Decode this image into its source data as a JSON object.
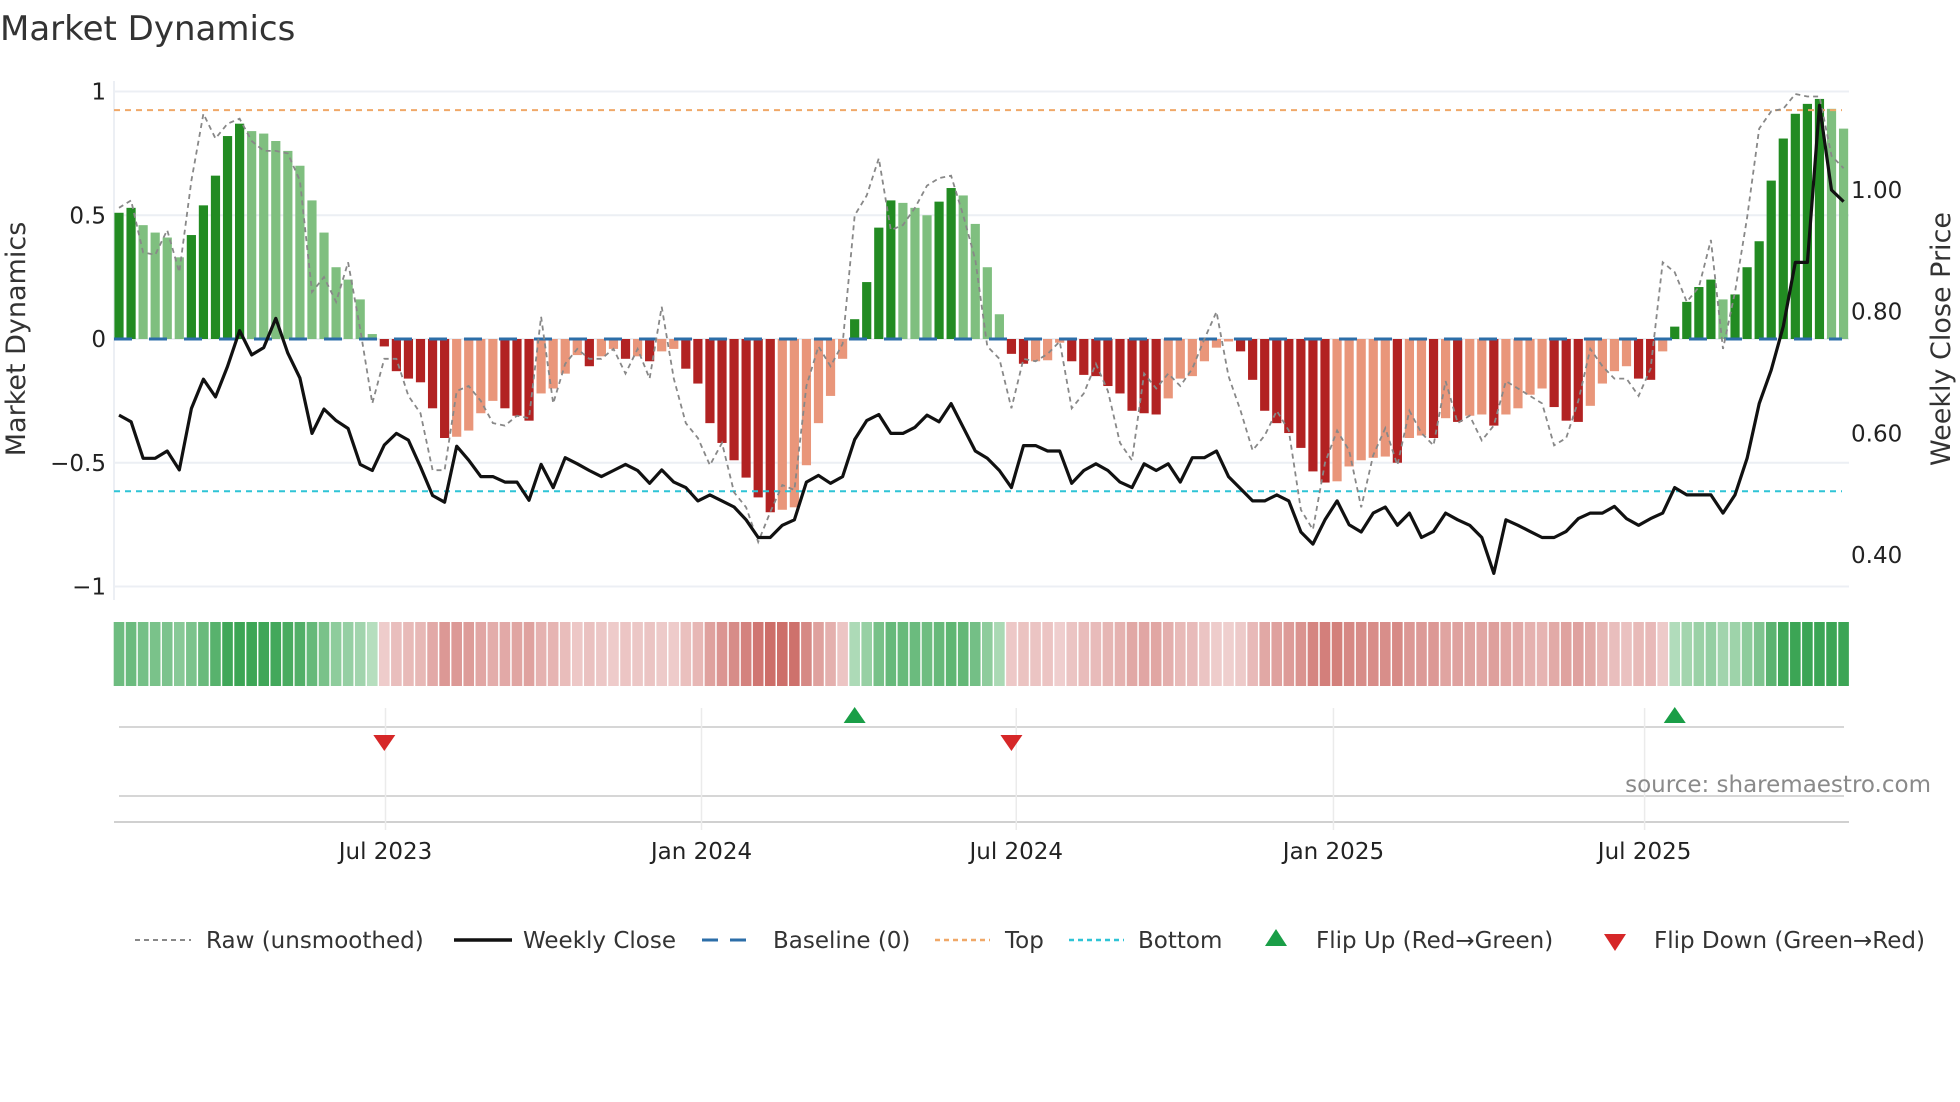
{
  "chart_data": {
    "type": "bar",
    "title": "Market Dynamics",
    "ylabel": "Market Dynamics",
    "ylabel_right": "Weekly Close Price",
    "xlabel": "",
    "ylim": [
      -1.055,
      1.04
    ],
    "ylim_right": [
      0.38,
      1.16
    ],
    "grid": true,
    "legend_placement": "bottom",
    "yticks": [
      {
        "value": 1,
        "label": "1"
      },
      {
        "value": 0.5,
        "label": "0.5"
      },
      {
        "value": 0,
        "label": "0"
      },
      {
        "value": -0.5,
        "label": "−0.5"
      },
      {
        "value": -1,
        "label": "−1"
      }
    ],
    "yticks_right": [
      {
        "value": 1.0,
        "label": "1.00"
      },
      {
        "value": 0.8,
        "label": "0.80"
      },
      {
        "value": 0.6,
        "label": "0.60"
      },
      {
        "value": 0.4,
        "label": "0.40"
      }
    ],
    "xticks": [
      {
        "week": 22.1,
        "label": "Jul 2023"
      },
      {
        "week": 48.3,
        "label": "Jan 2024"
      },
      {
        "week": 74.4,
        "label": "Jul 2024"
      },
      {
        "week": 100.7,
        "label": "Jan 2025"
      },
      {
        "week": 126.5,
        "label": "Jul 2025"
      }
    ],
    "thresholds": {
      "top": 0.925,
      "bottom": -0.615,
      "baseline": 0
    },
    "series": [
      {
        "name": "Market Dynamics (smoothed)",
        "values": [
          0.51,
          0.53,
          0.46,
          0.43,
          0.41,
          0.33,
          0.42,
          0.54,
          0.66,
          0.82,
          0.87,
          0.84,
          0.83,
          0.8,
          0.76,
          0.7,
          0.56,
          0.43,
          0.29,
          0.24,
          0.16,
          0.02,
          -0.03,
          -0.13,
          -0.16,
          -0.175,
          -0.28,
          -0.4,
          -0.395,
          -0.37,
          -0.3,
          -0.25,
          -0.28,
          -0.31,
          -0.33,
          -0.22,
          -0.2,
          -0.14,
          -0.065,
          -0.11,
          -0.07,
          -0.04,
          -0.08,
          -0.07,
          -0.09,
          -0.05,
          -0.04,
          -0.12,
          -0.18,
          -0.34,
          -0.42,
          -0.49,
          -0.56,
          -0.64,
          -0.7,
          -0.69,
          -0.68,
          -0.51,
          -0.34,
          -0.23,
          -0.08,
          0.08,
          0.23,
          0.45,
          0.56,
          0.55,
          0.53,
          0.5,
          0.555,
          0.61,
          0.58,
          0.465,
          0.29,
          0.1,
          -0.06,
          -0.1,
          -0.09,
          -0.086,
          -0.015,
          -0.09,
          -0.145,
          -0.15,
          -0.19,
          -0.22,
          -0.29,
          -0.3,
          -0.305,
          -0.24,
          -0.16,
          -0.15,
          -0.09,
          -0.035,
          -0.01,
          -0.05,
          -0.165,
          -0.29,
          -0.34,
          -0.38,
          -0.44,
          -0.535,
          -0.58,
          -0.575,
          -0.515,
          -0.49,
          -0.48,
          -0.475,
          -0.5,
          -0.4,
          -0.39,
          -0.4,
          -0.32,
          -0.335,
          -0.31,
          -0.305,
          -0.35,
          -0.305,
          -0.28,
          -0.225,
          -0.2,
          -0.275,
          -0.33,
          -0.335,
          -0.27,
          -0.18,
          -0.13,
          -0.11,
          -0.16,
          -0.165,
          -0.05,
          0.05,
          0.15,
          0.21,
          0.24,
          0.16,
          0.18,
          0.29,
          0.395,
          0.64,
          0.81,
          0.91,
          0.95,
          0.97,
          0.93,
          0.85
        ]
      },
      {
        "name": "Raw (unsmoothed)",
        "values": [
          0.53,
          0.56,
          0.35,
          0.34,
          0.44,
          0.27,
          0.64,
          0.91,
          0.81,
          0.87,
          0.89,
          0.8,
          0.76,
          0.76,
          0.75,
          0.64,
          0.19,
          0.25,
          0.15,
          0.31,
          0.04,
          -0.26,
          -0.08,
          -0.08,
          -0.23,
          -0.3,
          -0.53,
          -0.53,
          -0.21,
          -0.19,
          -0.25,
          -0.34,
          -0.35,
          -0.31,
          -0.32,
          0.09,
          -0.26,
          -0.1,
          -0.04,
          -0.08,
          -0.08,
          -0.04,
          -0.14,
          -0.04,
          -0.16,
          0.13,
          -0.16,
          -0.34,
          -0.4,
          -0.51,
          -0.42,
          -0.62,
          -0.68,
          -0.82,
          -0.7,
          -0.59,
          -0.61,
          -0.19,
          -0.03,
          -0.11,
          -0.02,
          0.5,
          0.58,
          0.73,
          0.44,
          0.46,
          0.53,
          0.62,
          0.65,
          0.66,
          0.5,
          0.32,
          -0.03,
          -0.08,
          -0.28,
          -0.08,
          -0.09,
          -0.06,
          -0.01,
          -0.28,
          -0.22,
          -0.1,
          -0.21,
          -0.42,
          -0.49,
          -0.14,
          -0.2,
          -0.14,
          -0.19,
          -0.12,
          0.0,
          0.11,
          -0.15,
          -0.29,
          -0.45,
          -0.39,
          -0.29,
          -0.37,
          -0.69,
          -0.77,
          -0.5,
          -0.37,
          -0.45,
          -0.68,
          -0.47,
          -0.36,
          -0.51,
          -0.29,
          -0.38,
          -0.43,
          -0.17,
          -0.34,
          -0.31,
          -0.41,
          -0.35,
          -0.17,
          -0.2,
          -0.23,
          -0.26,
          -0.43,
          -0.4,
          -0.25,
          -0.04,
          -0.11,
          -0.16,
          -0.16,
          -0.23,
          -0.12,
          0.31,
          0.27,
          0.15,
          0.21,
          0.4,
          -0.04,
          0.19,
          0.49,
          0.85,
          0.92,
          0.93,
          0.99,
          0.98,
          0.98,
          0.74,
          0.69
        ]
      },
      {
        "name": "Weekly Close",
        "axis": "right",
        "values": [
          0.63,
          0.619,
          0.559,
          0.559,
          0.571,
          0.54,
          0.641,
          0.689,
          0.66,
          0.71,
          0.769,
          0.729,
          0.741,
          0.789,
          0.732,
          0.691,
          0.6,
          0.64,
          0.621,
          0.608,
          0.549,
          0.539,
          0.581,
          0.6,
          0.589,
          0.545,
          0.498,
          0.487,
          0.579,
          0.556,
          0.529,
          0.529,
          0.52,
          0.52,
          0.49,
          0.549,
          0.511,
          0.56,
          0.55,
          0.539,
          0.529,
          0.539,
          0.549,
          0.539,
          0.518,
          0.54,
          0.52,
          0.511,
          0.489,
          0.499,
          0.489,
          0.479,
          0.458,
          0.429,
          0.429,
          0.449,
          0.458,
          0.52,
          0.531,
          0.518,
          0.529,
          0.59,
          0.621,
          0.631,
          0.6,
          0.6,
          0.61,
          0.63,
          0.619,
          0.649,
          0.61,
          0.571,
          0.559,
          0.539,
          0.511,
          0.58,
          0.58,
          0.571,
          0.571,
          0.518,
          0.539,
          0.55,
          0.539,
          0.52,
          0.511,
          0.55,
          0.539,
          0.55,
          0.52,
          0.56,
          0.56,
          0.571,
          0.529,
          0.509,
          0.489,
          0.489,
          0.499,
          0.489,
          0.438,
          0.418,
          0.458,
          0.489,
          0.45,
          0.438,
          0.469,
          0.479,
          0.449,
          0.469,
          0.429,
          0.439,
          0.469,
          0.458,
          0.449,
          0.429,
          0.37,
          0.458,
          0.449,
          0.439,
          0.429,
          0.429,
          0.439,
          0.46,
          0.469,
          0.469,
          0.48,
          0.46,
          0.449,
          0.46,
          0.469,
          0.511,
          0.499,
          0.499,
          0.499,
          0.469,
          0.499,
          0.559,
          0.649,
          0.704,
          0.776,
          0.881,
          0.881,
          1.139,
          1.0,
          0.981
        ]
      }
    ],
    "legend": [
      {
        "key": "raw",
        "label": "Raw (unsmoothed)"
      },
      {
        "key": "close",
        "label": "Weekly Close"
      },
      {
        "key": "baseline",
        "label": "Baseline (0)"
      },
      {
        "key": "top",
        "label": "Top"
      },
      {
        "key": "bottom",
        "label": "Bottom"
      },
      {
        "key": "flip_up",
        "label": "Flip Up (Red→Green)"
      },
      {
        "key": "flip_down",
        "label": "Flip Down (Green→Red)"
      }
    ],
    "colors": {
      "pos_strong": "#228b22",
      "pos_weak": "#7fbf7f",
      "neg_strong": "#b22222",
      "neg_weak": "#e9967a",
      "raw": "#888888",
      "close": "#111111",
      "baseline": "#2c6ea8",
      "top": "#f0a868",
      "bottom": "#2ec4d6",
      "flip_up": "#1a9e47",
      "flip_down": "#d62728",
      "grid": "#eceff4"
    }
  },
  "source": "source: sharemaestro.com"
}
